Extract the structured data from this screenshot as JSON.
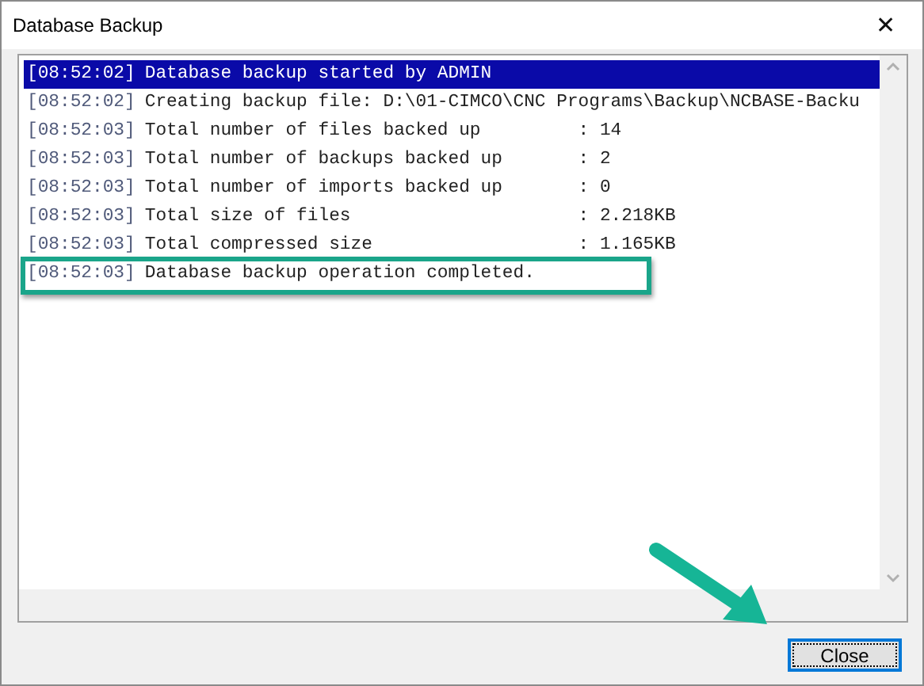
{
  "window": {
    "title": "Database Backup",
    "close_glyph": "✕"
  },
  "log": [
    {
      "time": "[08:52:02]",
      "message": "Database backup started by ADMIN",
      "selected": true,
      "highlighted": false
    },
    {
      "time": "[08:52:02]",
      "message": "Creating backup file: D:\\01-CIMCO\\CNC Programs\\Backup\\NCBASE-Backu",
      "selected": false,
      "highlighted": false
    },
    {
      "time": "[08:52:03]",
      "message": "Total number of files backed up         : 14",
      "selected": false,
      "highlighted": false
    },
    {
      "time": "[08:52:03]",
      "message": "Total number of backups backed up       : 2",
      "selected": false,
      "highlighted": false
    },
    {
      "time": "[08:52:03]",
      "message": "Total number of imports backed up       : 0",
      "selected": false,
      "highlighted": false
    },
    {
      "time": "[08:52:03]",
      "message": "Total size of files                     : 2.218KB",
      "selected": false,
      "highlighted": false
    },
    {
      "time": "[08:52:03]",
      "message": "Total compressed size                   : 1.165KB",
      "selected": false,
      "highlighted": false
    },
    {
      "time": "[08:52:03]",
      "message": "Database backup operation completed.",
      "selected": false,
      "highlighted": true
    }
  ],
  "buttons": [
    {
      "label": "Close"
    }
  ]
}
